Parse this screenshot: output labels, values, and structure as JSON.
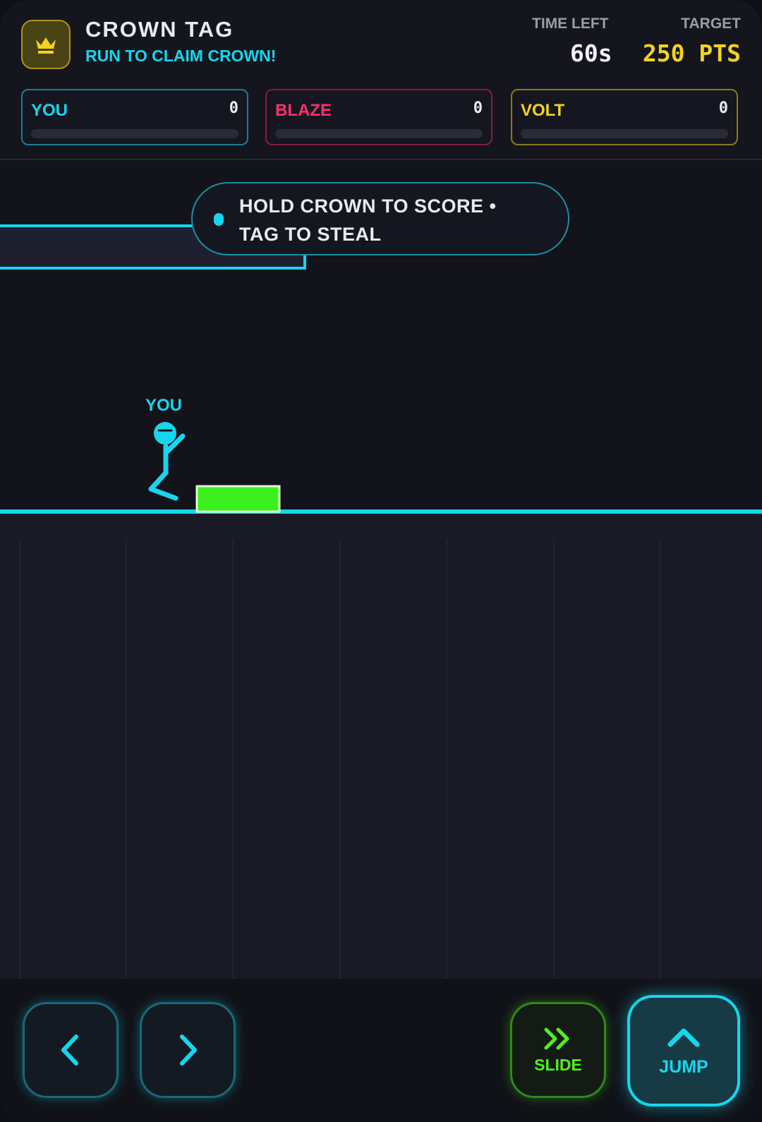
{
  "header": {
    "title": "CROWN TAG",
    "subtitle": "RUN TO CLAIM CROWN!",
    "logo_icon": "crown-icon",
    "time_left_label": "TIME LEFT",
    "time_left_value": "60s",
    "target_label": "TARGET",
    "target_value": "250 PTS"
  },
  "players": [
    {
      "name": "YOU",
      "score": "0",
      "progress": 0,
      "color": "#16d6ee",
      "border": "#1a7f92"
    },
    {
      "name": "BLAZE",
      "score": "0",
      "progress": 0,
      "color": "#ff2f6e",
      "border": "#8a1d3b"
    },
    {
      "name": "VOLT",
      "score": "0",
      "progress": 0,
      "color": "#f3d320",
      "border": "#8a7a1a"
    }
  ],
  "arena": {
    "tip": "HOLD CROWN TO SCORE • TAG TO STEAL",
    "player_label": "YOU"
  },
  "controls": {
    "left_icon": "chevron-left-icon",
    "right_icon": "chevron-right-icon",
    "slide_icon": "double-chevron-right-icon",
    "slide_label": "SLIDE",
    "jump_icon": "chevron-up-icon",
    "jump_label": "JUMP"
  },
  "colors": {
    "accent": "#16d6ee",
    "gold": "#f3d320",
    "slide": "#50f01e",
    "crate": "#3cf01e"
  }
}
